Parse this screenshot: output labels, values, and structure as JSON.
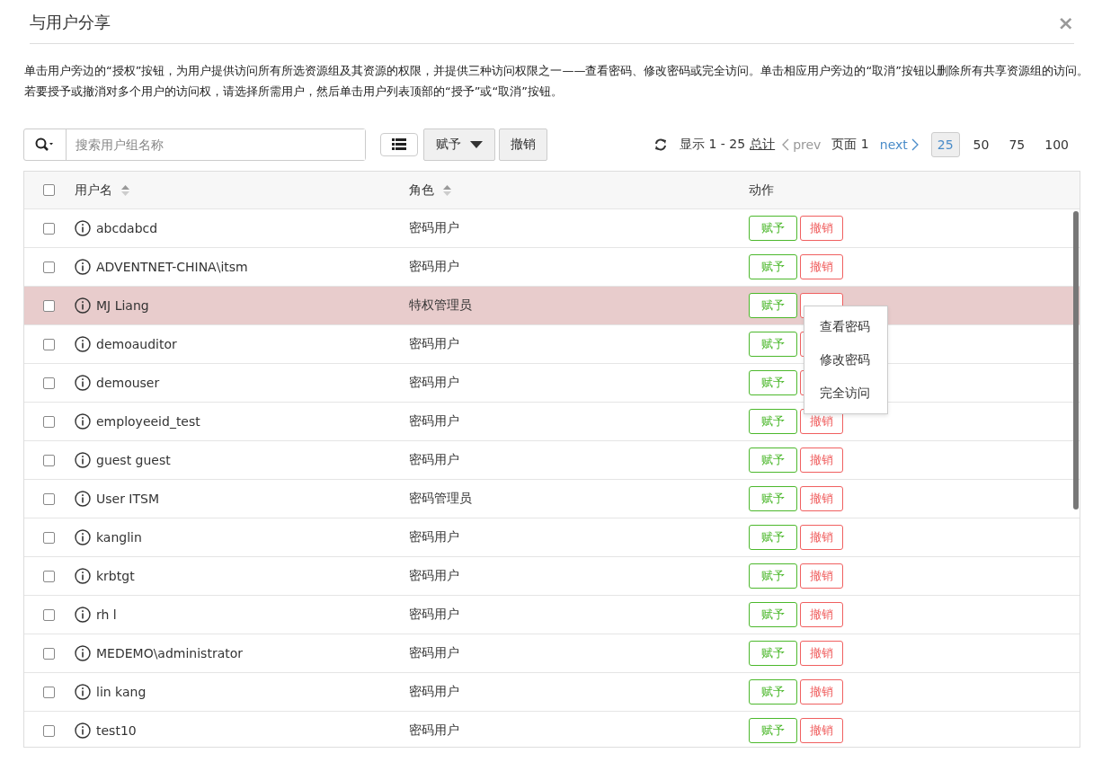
{
  "dialog": {
    "title": "与用户分享",
    "close": "×",
    "description": "单击用户旁边的“授权”按钮，为用户提供访问所有所选资源组及其资源的权限，并提供三种访问权限之一——查看密码、修改密码或完全访问。单击相应用户旁边的“取消”按钮以删除所有共享资源组的访问。若要授予或撤消对多个用户的访问权，请选择所需用户，然后单击用户列表顶部的“授予”或“取消”按钮。"
  },
  "toolbar": {
    "search": {
      "placeholder": "搜索用户组名称"
    },
    "grant": "赋予",
    "revoke": "撤销"
  },
  "pagination": {
    "showing": "显示 1 - 25",
    "total": "总计",
    "prev": "prev",
    "page": "页面 1",
    "next": "next",
    "sizes": [
      {
        "label": "25",
        "selected": true
      },
      {
        "label": "50",
        "selected": false
      },
      {
        "label": "75",
        "selected": false
      },
      {
        "label": "100",
        "selected": false
      }
    ]
  },
  "table": {
    "columns": [
      "用户名",
      "角色",
      "动作"
    ],
    "header_checked": false,
    "rows": [
      {
        "name": "abcdabcd",
        "role": "密码用户",
        "grant": "赋予",
        "revoke": "撤销",
        "checked": false,
        "selected": false
      },
      {
        "name": "ADVENTNET-CHINA\\itsm",
        "role": "密码用户",
        "grant": "赋予",
        "revoke": "撤销",
        "checked": false,
        "selected": false
      },
      {
        "name": "MJ Liang",
        "role": "特权管理员",
        "grant": "赋予",
        "checked": false,
        "selected": true,
        "expanded": true,
        "menu": [
          "查看密码",
          "修改密码",
          "完全访问"
        ]
      },
      {
        "name": "demoauditor",
        "role": "密码用户",
        "grant": "赋予",
        "checked": false,
        "selected": false
      },
      {
        "name": "demouser",
        "role": "密码用户",
        "grant": "赋予",
        "checked": false,
        "selected": false
      },
      {
        "name": "employeeid_test",
        "role": "密码用户",
        "grant": "赋予",
        "revoke": "撤销",
        "checked": false,
        "selected": false
      },
      {
        "name": "guest guest",
        "role": "密码用户",
        "grant": "赋予",
        "revoke": "撤销",
        "checked": false,
        "selected": false
      },
      {
        "name": "User ITSM",
        "role": "密码管理员",
        "grant": "赋予",
        "revoke": "撤销",
        "checked": false,
        "selected": false
      },
      {
        "name": "kanglin",
        "role": "密码用户",
        "grant": "赋予",
        "revoke": "撤销",
        "checked": false,
        "selected": false
      },
      {
        "name": "krbtgt",
        "role": "密码用户",
        "grant": "赋予",
        "revoke": "撤销",
        "checked": false,
        "selected": false
      },
      {
        "name": "rh l",
        "role": "密码用户",
        "grant": "赋予",
        "revoke": "撤销",
        "checked": false,
        "selected": false
      },
      {
        "name": "MEDEMO\\administrator",
        "role": "密码用户",
        "grant": "赋予",
        "revoke": "撤销",
        "checked": false,
        "selected": false
      },
      {
        "name": "lin kang",
        "role": "密码用户",
        "grant": "赋予",
        "revoke": "撤销",
        "checked": false,
        "selected": false
      },
      {
        "name": "test10",
        "role": "密码用户",
        "grant": "赋予",
        "revoke": "撤销",
        "checked": false,
        "selected": false
      }
    ]
  }
}
